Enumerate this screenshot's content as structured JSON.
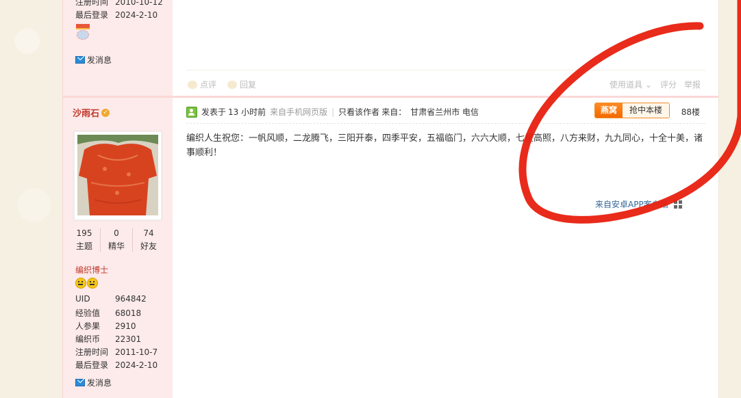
{
  "upper_profile": {
    "reg_label": "注册时间",
    "reg_value": "2010-10-12",
    "last_login_label": "最后登录",
    "last_login_value": "2024-2-10",
    "message_label": "发消息"
  },
  "upper_post_actions": {
    "rate": "点评",
    "reply": "回复",
    "use_tools": "使用道具",
    "score": "评分",
    "report": "举报"
  },
  "user": {
    "name": "沙雨石",
    "stats": [
      {
        "value": "195",
        "label": "主题"
      },
      {
        "value": "0",
        "label": "精华"
      },
      {
        "value": "74",
        "label": "好友"
      }
    ],
    "rank": "编织博士",
    "fields": [
      {
        "label": "UID",
        "value": "964842"
      },
      {
        "label": "经验值",
        "value": "68018"
      },
      {
        "label": "人参果",
        "value": "2910"
      },
      {
        "label": "编织币",
        "value": "22301"
      },
      {
        "label": "注册时间",
        "value": "2011-10-7"
      },
      {
        "label": "最后登录",
        "value": "2024-2-10"
      }
    ],
    "message_label": "发消息"
  },
  "post": {
    "posted_prefix": "发表于",
    "posted_time": "13 小时前",
    "source": "来自手机网页版",
    "only_author": "只看该作者",
    "from_label": "来自：",
    "location": "甘肃省兰州市 电信",
    "badge_tag": "燕窝",
    "badge_action": "抢中本楼",
    "floor": "88楼",
    "content": "编织人生祝您：一帆风顺，二龙腾飞，三阳开泰，四季平安，五福临门，六六大顺，七星高照，八方来财，九九同心，十全十美，诸事顺利！",
    "app_source": "来自安卓APP客户端"
  },
  "colors": {
    "scribble": "#e8200f",
    "username": "#c0392b",
    "sidebar_bg": "#fdeaea",
    "badge_orange": "#f26a00"
  }
}
